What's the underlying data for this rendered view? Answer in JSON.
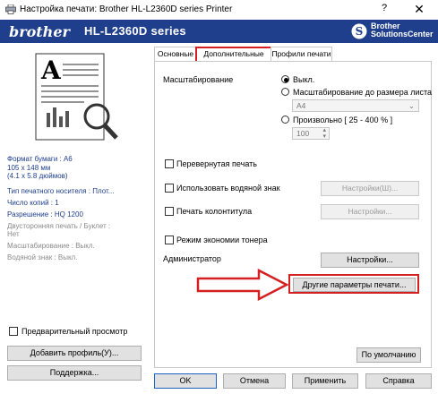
{
  "window": {
    "title": "Настройка печати: Brother HL-L2360D series Printer",
    "help": "?",
    "close": "✕"
  },
  "header": {
    "brand": "brother",
    "model": "HL-L2360D series",
    "logo_line1": "Brother",
    "logo_line2": "SolutionsCenter"
  },
  "preview": {
    "letter": "A"
  },
  "summary": {
    "paper_size": "Формат бумаги : A6",
    "dims_mm": "105 x 148 мм",
    "dims_in": "(4.1 x 5.8 дюймов)",
    "media_type": "Тип печатного носителя : Плот...",
    "copies": "Число копий : 1",
    "resolution": "Разрешение : HQ 1200",
    "duplex": "Двусторонняя печать / Буклет :",
    "duplex_val": "Нет",
    "scaling": "Масштабирование : Выкл.",
    "watermark": "Водяной знак : Выкл."
  },
  "left": {
    "preview_checkbox": "Предварительный просмотр",
    "add_profile": "Добавить профиль(У)...",
    "support": "Поддержка..."
  },
  "tabs": [
    "Основные",
    "Дополнительные",
    "Профили печати"
  ],
  "scaling": {
    "label": "Масштабирование",
    "opt_off": "Выкл.",
    "opt_fit": "Масштабирование до размера листа",
    "paper": "A4",
    "opt_free": "Произвольно [ 25 - 400 % ]",
    "percent": "100"
  },
  "options": {
    "reverse": "Перевернутая печать",
    "watermark": "Использовать водяной знак",
    "watermark_btn": "Настройки(Ш)...",
    "header_footer": "Печать колонтитула",
    "header_footer_btn": "Настройки...",
    "toner_save": "Режим экономии тонера",
    "admin": "Администратор",
    "admin_btn": "Настройки...",
    "other_params": "Другие параметры печати...",
    "default_btn": "По умолчанию"
  },
  "footer": {
    "ok": "OK",
    "cancel": "Отмена",
    "apply": "Применить",
    "help": "Справка"
  },
  "colors": {
    "header_bg": "#1f3f8c",
    "highlight": "#d42020",
    "summary_text": "#1f3f8c"
  }
}
